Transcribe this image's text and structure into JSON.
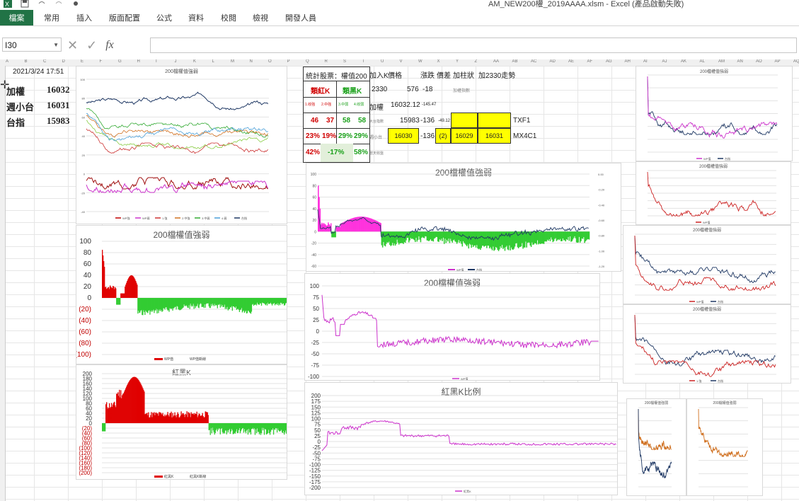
{
  "window": {
    "title": "AM_NEW200權_2019AAAA.xlsm - Excel (產品啟動失敗)"
  },
  "ribbon": {
    "tabs": [
      "檔案",
      "常用",
      "插入",
      "版面配置",
      "公式",
      "資料",
      "校閱",
      "檢視",
      "開發人員"
    ]
  },
  "formula_bar": {
    "name_box": "I30",
    "formula": ""
  },
  "column_headers": [
    "A",
    "B",
    "C",
    "D",
    "E",
    "F",
    "G",
    "H",
    "I",
    "J",
    "K",
    "L",
    "M",
    "N",
    "O",
    "P",
    "Q",
    "R",
    "S",
    "T",
    "U",
    "V",
    "W",
    "X",
    "Y",
    "Z",
    "AA",
    "AB",
    "AC",
    "AD",
    "AE",
    "AF",
    "AG",
    "AH",
    "AI",
    "AJ",
    "AK",
    "AL",
    "AM",
    "AN",
    "AO",
    "AP",
    "AQ"
  ],
  "index_panel": {
    "timestamp": "2021/3/24 17:51",
    "rows": [
      {
        "label": "加權",
        "value": "16032"
      },
      {
        "label": "週小台",
        "value": "16031"
      },
      {
        "label": "台指",
        "value": "15983"
      }
    ]
  },
  "stats_table": {
    "title": "統計股票：權值200",
    "red_k": "類紅K",
    "black_k": "類黑K",
    "sub_labels": [
      "1.收強",
      "2.中強",
      "3.中弱",
      "4.收弱"
    ],
    "counts": [
      "46",
      "37",
      "58",
      "58"
    ],
    "pcts": [
      "23%",
      "19%",
      "29%",
      "29%"
    ],
    "summary": [
      "42%",
      "-17%",
      "58%"
    ],
    "side_note": "當天收盤"
  },
  "quote_panel": {
    "headers": [
      "加入K",
      "價格",
      "漲跌",
      "價差",
      "加柱狀",
      "加2330走勢"
    ],
    "row1": {
      "label": "2330",
      "price": "576",
      "change": "-18",
      "note": "加權指數"
    },
    "row2": {
      "label": "加權",
      "price": "16032.12",
      "change": "-145.47"
    },
    "row3": {
      "label": "大台指數",
      "price": "15983",
      "change": "-136",
      "diff": "-49.12",
      "right": "TXF1"
    },
    "row4": {
      "label": "週小台",
      "price": "16030",
      "change": "-136",
      "diff": "(2)",
      "v1": "16029",
      "v2": "16031",
      "right": "MX4C1"
    }
  },
  "charts": {
    "c1": {
      "title": "200檔權值強弱",
      "legend": [
        "WP強",
        "WP弱",
        "1.強",
        "2.中強",
        "3.中弱",
        "4.弱",
        "台指"
      ]
    },
    "c2": {
      "title": "200檔權值強弱",
      "legend": [
        "WP值",
        "WP值斷線"
      ]
    },
    "c3": {
      "title": "紅黑K",
      "legend": [
        "紅黑K",
        "紅黑K斷線"
      ]
    },
    "c4": {
      "title": "200檔權值強弱",
      "legend": [
        "WP值",
        "台指"
      ]
    },
    "c5": {
      "title": "200檔權值強弱",
      "legend": [
        "WP值"
      ]
    },
    "c6": {
      "title": "紅黑K比例",
      "legend": [
        "紅黑K"
      ]
    },
    "r1": {
      "title": "200檔權值強弱",
      "legend": [
        "WP值",
        "台指"
      ]
    },
    "r2": {
      "title": "200檔權值強弱",
      "legend": [
        "WP值"
      ]
    },
    "r3": {
      "title": "200檔權值強弱",
      "legend": [
        "WP值",
        "台指"
      ]
    },
    "r4": {
      "title": "200檔權值強弱",
      "legend": [
        "1.強",
        "台指"
      ]
    },
    "s1": {
      "title": "200檔權值強弱"
    },
    "s2": {
      "title": "200檔權值強弱"
    }
  },
  "axes": {
    "c2_y": [
      "100",
      "80",
      "60",
      "40",
      "20",
      "0",
      "(20)",
      "(40)",
      "(60)",
      "(80)",
      "(100)"
    ],
    "c3_y": [
      "200",
      "180",
      "160",
      "140",
      "120",
      "100",
      "80",
      "60",
      "40",
      "20",
      "0",
      "(20)",
      "(40)",
      "(60)",
      "(80)",
      "(100)",
      "(120)",
      "(140)",
      "(160)",
      "(180)",
      "(200)"
    ],
    "c5_y": [
      "100",
      "75",
      "50",
      "25",
      "0",
      "-25",
      "-50",
      "-75",
      "-100"
    ],
    "c6_y": [
      "200",
      "175",
      "150",
      "125",
      "100",
      "75",
      "50",
      "25",
      "0",
      "-25",
      "-50",
      "-75",
      "-100",
      "-125",
      "-150",
      "-175",
      "-200"
    ],
    "c1_y": [
      "100",
      "80",
      "60",
      "40",
      "20",
      "0",
      "-20",
      "-40"
    ],
    "c4_y": [
      "100",
      "80",
      "60",
      "40",
      "20",
      "0",
      "-20",
      "-40",
      "-60"
    ]
  },
  "colors": {
    "excel_green": "#217346",
    "red": "#d00000",
    "green": "#33cc33",
    "magenta": "#cc33cc",
    "navy": "#1f3864",
    "orange": "#d07020",
    "yellow": "#ffff00"
  }
}
